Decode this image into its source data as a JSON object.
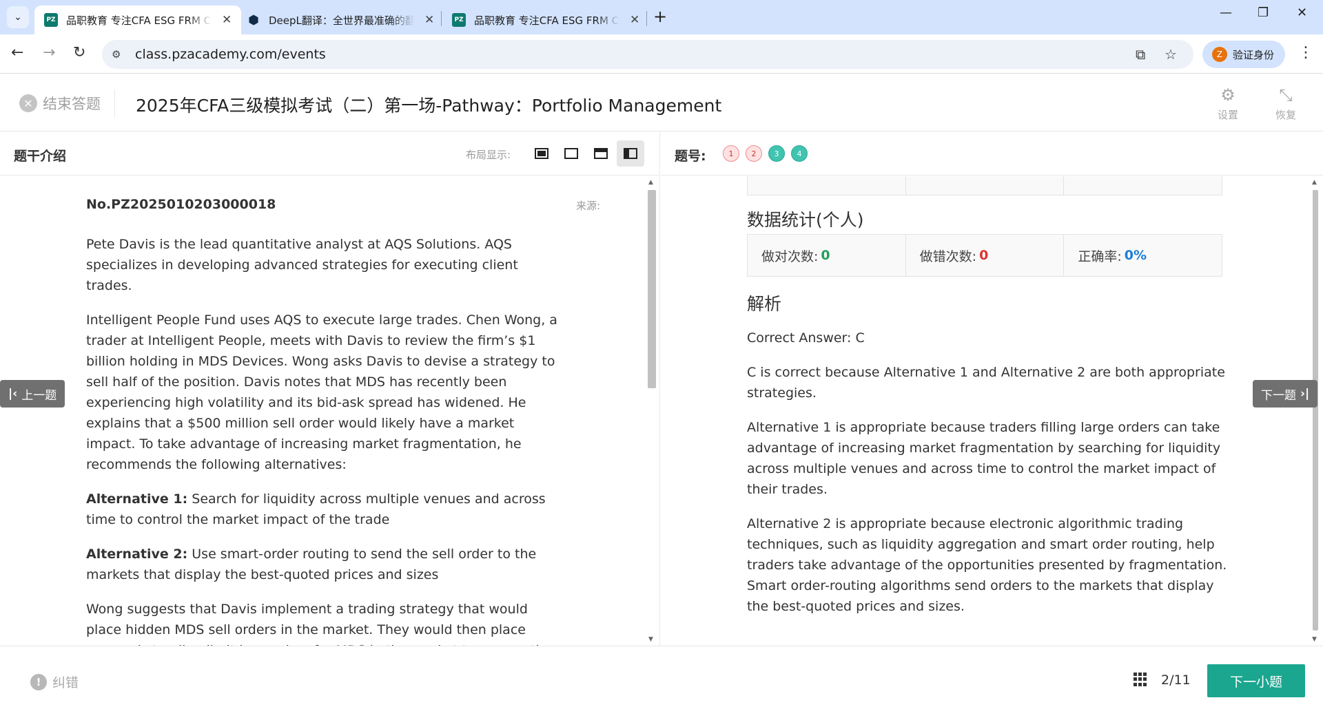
{
  "browser": {
    "tabs": [
      {
        "title": "品职教育 专注CFA ESG FRM CPA",
        "active": true,
        "icon": "pz-favicon"
      },
      {
        "title": "DeepL翻译：全世界最准确的翻译",
        "active": false,
        "icon": "deepl-favicon"
      },
      {
        "title": "品职教育 专注CFA ESG FRM CPA",
        "active": false,
        "icon": "pz-favicon"
      }
    ],
    "url": "class.pzacademy.com/events",
    "profile_label": "验证身份",
    "profile_initial": "Z"
  },
  "header": {
    "exit_label": "结束答题",
    "title": "2025年CFA三级模拟考试（二）第一场-Pathway：Portfolio Management",
    "settings_label": "设置",
    "restore_label": "恢复"
  },
  "left": {
    "section_label": "题干介绍",
    "layout_label": "布局显示:",
    "question_no": "No.PZ2025010203000018",
    "source_label": "来源:",
    "paragraphs": {
      "p1": "Pete Davis is the lead quantitative analyst at AQS Solutions. AQS specializes in developing advanced strategies for executing client trades.",
      "p2": "Intelligent People Fund uses AQS to execute large trades. Chen Wong, a trader at Intelligent People, meets with Davis to review the firm’s $1 billion holding in MDS Devices. Wong asks Davis to devise a strategy to sell half of the position. Davis notes that MDS has recently been experiencing high volatility and its bid-ask spread has widened. He explains that a $500 million sell order would likely have a market impact. To take advantage of increasing market fragmentation, he recommends the following alternatives:",
      "alt1_label": "Alternative 1:",
      "alt1_text": " Search for liquidity across multiple venues and across time to control the market impact of the trade",
      "alt2_label": "Alternative 2:",
      "alt2_text": " Use smart-order routing to send the sell order to the markets that display the best-quoted prices and sizes",
      "p5": "Wong suggests that Davis implement a trading strategy that would place hidden MDS sell orders in the market. They would then place exposed standing limit buy orders for MDS in the market to convey the impression that prices may soon increase. After other traders buy into Intelligent People’s"
    }
  },
  "right": {
    "section_label": "题号:",
    "questions": [
      {
        "num": "1",
        "status": "wrong"
      },
      {
        "num": "2",
        "status": "wrong"
      },
      {
        "num": "3",
        "status": "right"
      },
      {
        "num": "4",
        "status": "right"
      }
    ],
    "stats_title": "数据统计(个人)",
    "stats": {
      "correct_label": "做对次数:",
      "correct_value": "0",
      "wrong_label": "做错次数:",
      "wrong_value": "0",
      "rate_label": "正确率:",
      "rate_value": "0%"
    },
    "analysis_title": "解析",
    "analysis": {
      "p1": "Correct Answer: C",
      "p2": "C is correct because Alternative 1 and Alternative 2 are both appropriate strategies.",
      "p3": "Alternative 1 is appropriate because traders filling large orders can take advantage of increasing market fragmentation by searching for liquidity across multiple venues and across time to control the market impact of their trades.",
      "p4": "Alternative 2 is appropriate because electronic algorithmic trading techniques, such as liquidity aggregation and smart order routing, help traders take advantage of the opportunities presented by fragmentation. Smart order-routing algorithms send orders to the markets that display the best-quoted prices and sizes."
    }
  },
  "nav": {
    "prev_label": "上一题",
    "next_label": "下一题"
  },
  "footer": {
    "report_label": "纠错",
    "progress": "2/11",
    "next_sub_label": "下一小题"
  },
  "colors": {
    "accent": "#1aa68f",
    "correct": "#22a05a",
    "wrong": "#e03131",
    "rate": "#1c7ed6"
  }
}
